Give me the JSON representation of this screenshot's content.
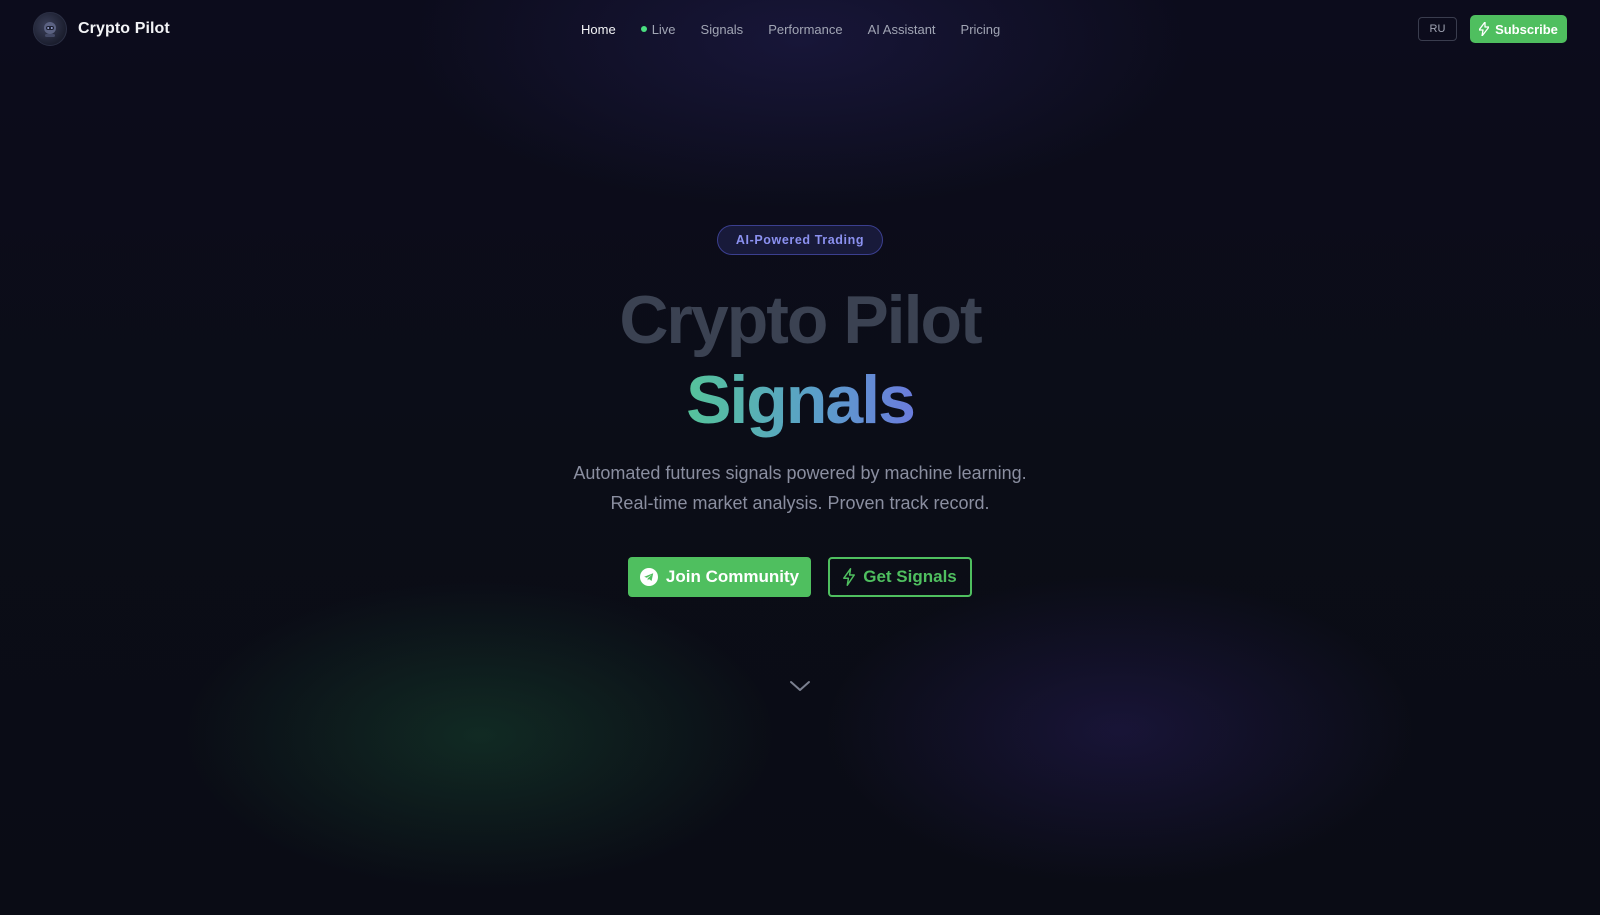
{
  "header": {
    "brand_name": "Crypto Pilot",
    "nav": [
      {
        "label": "Home",
        "active": true
      },
      {
        "label": "Live",
        "live": true
      },
      {
        "label": "Signals"
      },
      {
        "label": "Performance"
      },
      {
        "label": "AI Assistant"
      },
      {
        "label": "Pricing"
      }
    ],
    "language": "RU",
    "subscribe_label": "Subscribe"
  },
  "hero": {
    "badge": "AI-Powered Trading",
    "title_line1": "Crypto Pilot",
    "title_line2": "Signals",
    "subtitle_line1": "Automated futures signals powered by machine learning.",
    "subtitle_line2": "Real-time market analysis. Proven track record.",
    "primary_cta": "Join Community",
    "secondary_cta": "Get Signals"
  },
  "colors": {
    "accent_green": "#4fbf5f",
    "badge_text": "#8b91f0",
    "background": "#0b0c18"
  },
  "icons": {
    "brand": "robot-avatar-icon",
    "subscribe": "lightning-icon",
    "join": "telegram-icon",
    "signals": "lightning-icon",
    "scroll": "chevron-down-icon"
  }
}
